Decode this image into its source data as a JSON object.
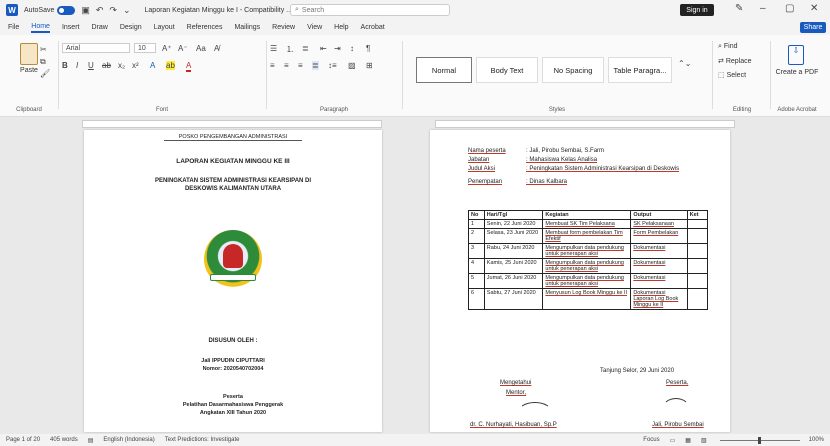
{
  "titlebar": {
    "autosave_label": "AutoSave",
    "toggle_state": "Off",
    "doc_title": "Laporan Kegiatan Minggu ke I - Compatibility ...",
    "search_placeholder": "Search",
    "signin_label": "Sign in"
  },
  "menu": {
    "items": [
      "File",
      "Home",
      "Insert",
      "Draw",
      "Design",
      "Layout",
      "References",
      "Mailings",
      "Review",
      "View",
      "Help",
      "Acrobat"
    ],
    "share": "Share"
  },
  "ribbon": {
    "clipboard": {
      "paste": "Paste",
      "label": "Clipboard"
    },
    "font": {
      "name": "Arial",
      "size": "10",
      "label": "Font"
    },
    "paragraph": {
      "label": "Paragraph"
    },
    "styles": {
      "items": [
        "Normal",
        "Body Text",
        "No Spacing",
        "Table Paragra..."
      ],
      "label": "Styles"
    },
    "editing": {
      "find": "Find",
      "replace": "Replace",
      "select": "Select",
      "label": "Editing"
    },
    "adobe": {
      "create": "Create a PDF",
      "label": "Adobe Acrobat"
    }
  },
  "page1": {
    "header": "POSKO PENGEMBANGAN ADMINISTRASI",
    "title": "LAPORAN KEGIATAN MINGGU KE III",
    "subtitle1": "PENINGKATAN SISTEM ADMINISTRASI KEARSIPAN DI",
    "subtitle2": "DESKOWIS KALIMANTAN UTARA",
    "disusun": "DISUSUN OLEH :",
    "name": "Jali IPPUDIN CIPUTTARI",
    "nim": "Nomor: 2020540702004",
    "inst1": "Peserta",
    "inst2": "Pelatihan Dasarmahasiswa Penggerak",
    "inst3": "Angkatan XIII Tahun 2020"
  },
  "page2": {
    "meta": [
      {
        "label": "Nama peserta",
        "value": ": Jali, Pirobu Sembai, S.Farm"
      },
      {
        "label": "Jabatan",
        "value": ": Mahasiswa Kelas Analisa"
      },
      {
        "label": "Judul Aksi",
        "value": ": Peningkatan Sistem Administrasi Kearsipan di Deskowis"
      },
      {
        "label": "Penempatan",
        "value": ": Dinas Kalbara"
      }
    ],
    "table_headers": [
      "No",
      "Hari/Tgl",
      "Kegiatan",
      "Output",
      "Ket"
    ],
    "rows": [
      {
        "no": "1",
        "date": "Senin, 22 Juni 2020",
        "activity": "Membuat SK Tim Pelaksana",
        "output": "SK Pelaksanaan",
        "note": ""
      },
      {
        "no": "2",
        "date": "Selasa, 23 Juni 2020",
        "activity": "Membuat form pembelakan Tim Efektif",
        "output": "Form Pembelakan",
        "note": ""
      },
      {
        "no": "3",
        "date": "Rabu, 24 Juni 2020",
        "activity": "Mengumpulkan data pendukung untuk penerapan aksi",
        "output": "Dokumentasi",
        "note": ""
      },
      {
        "no": "4",
        "date": "Kamis, 25 Juni 2020",
        "activity": "Mengumpulkan data pendukung untuk penerapan aksi",
        "output": "Dokumentasi",
        "note": ""
      },
      {
        "no": "5",
        "date": "Jumat, 26 Juni 2020",
        "activity": "Mengumpulkan data pendukung untuk penerapan aksi",
        "output": "Dokumentasi",
        "note": ""
      },
      {
        "no": "6",
        "date": "Sabtu, 27 Juni 2020",
        "activity": "Menyusun Log Book Minggu ke II",
        "output": "Dokumentasi Laporan Log Book Minggu ke II",
        "note": ""
      }
    ],
    "place_date": "Tanjung Selor, 29 Juni 2020",
    "left_role": "Mengetahui",
    "left_role2": "Mentor,",
    "left_name": "dr. C. Nurhayati, Hasibuan, Sp.P",
    "right_role": "Peserta,",
    "right_name": "Jali, Pirobu Sembai"
  },
  "status": {
    "page": "Page 1 of 20",
    "words": "405 words",
    "language": "English (Indonesia)",
    "accessibility": "Text Predictions: Investigate",
    "focus": "Focus",
    "zoom": "100%"
  }
}
